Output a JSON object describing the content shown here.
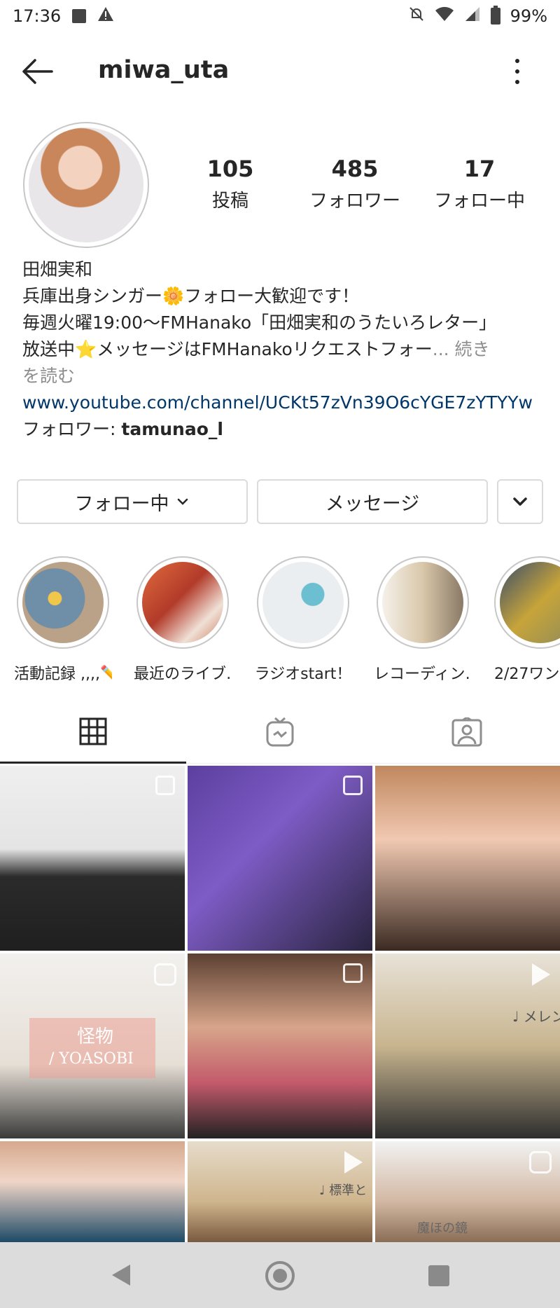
{
  "status_bar": {
    "time": "17:36",
    "battery": "99%"
  },
  "header": {
    "username": "miwa_uta"
  },
  "profile": {
    "stats": [
      {
        "num": "105",
        "label": "投稿"
      },
      {
        "num": "485",
        "label": "フォロワー"
      },
      {
        "num": "17",
        "label": "フォロー中"
      }
    ],
    "bio": {
      "name": "田畑実和",
      "line1": "兵庫出身シンガー🌼フォロー大歓迎です！",
      "line2": "毎週火曜19:00〜FMHanako「田畑実和のうたいろレター」",
      "line3": "放送中⭐メッセージはFMHanakoリクエストフォー",
      "more_ellipsis": "... 続き",
      "more_read": "を読む",
      "link": "www.youtube.com/channel/UCKt57zVn39O6cYGE7zYTYYw",
      "followed_prefix": "フォロワー: ",
      "followed_user": "tamunao_l"
    }
  },
  "buttons": {
    "following": "フォロー中",
    "message": "メッセージ"
  },
  "highlights": [
    {
      "label": "活動記録 ,,,,✏️",
      "color": "#6c8aa8"
    },
    {
      "label": "最近のライブ…",
      "color": "#c55a2d"
    },
    {
      "label": "ラジオstart！",
      "color": "#8fb8c4"
    },
    {
      "label": "レコーディン…",
      "color": "#c8b89a"
    },
    {
      "label": "2/27ワン",
      "color": "#a59a3d"
    }
  ],
  "tabs": [
    "grid-tab",
    "igtv-tab",
    "tagged-tab"
  ],
  "posts": [
    {
      "type": "multi",
      "bg": "linear-gradient(180deg,#efefef 0%,#e4e4e4 45%,#2b2b2b 60%,#1f1f1f 100%)"
    },
    {
      "type": "multi",
      "bg": "linear-gradient(135deg,#5b3f9e 0%,#7e5cc6 40%,#2a2440 100%)"
    },
    {
      "type": "none",
      "bg": "linear-gradient(180deg,#c0875e 0%,#f1c9b2 40%,#3b2a22 100%)"
    },
    {
      "type": "igtv",
      "bg": "linear-gradient(180deg,#f2f0ee 0%,#e6dfd6 60%,#3a3a3a 100%)",
      "caption1": "怪物",
      "caption2": "/ YOASOBI"
    },
    {
      "type": "multi",
      "bg": "linear-gradient(180deg,#5c4032 0%,#d7a58a 40%,#c35a6b 70%,#222 100%)"
    },
    {
      "type": "video",
      "bg": "linear-gradient(180deg,#e8e2d8 0%,#c8b58f 50%,#2d2d2d 100%)",
      "caption1": "♩ メレン"
    },
    {
      "type": "none",
      "bg": "linear-gradient(180deg,#d6a98e 0%,#f0d5c7 40%,#1e4a66 100%)"
    },
    {
      "type": "video",
      "bg": "linear-gradient(180deg,#e6dccb 0%,#cfb58d 60%,#7a5a3f 100%)",
      "caption1": "♩ 標準と"
    },
    {
      "type": "igtv",
      "bg": "linear-gradient(180deg,#f2f2f2 0%,#d2b8a3 60%,#8a6d55 100%)",
      "caption1": "魔ほの鏡"
    }
  ]
}
